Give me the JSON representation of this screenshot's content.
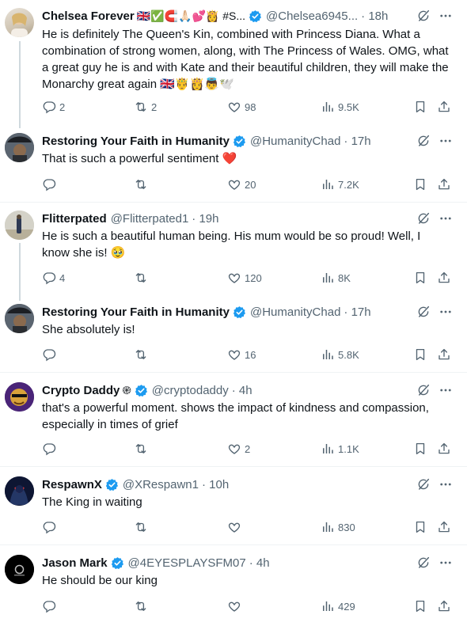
{
  "tweets": [
    {
      "name": "Chelsea Forever",
      "name_emojis": "🇬🇧✅🧲🙏🏻💕👸 #S...",
      "handle": "@Chelsea6945...",
      "time": "· 18h",
      "body": "He is definitely The Queen's Kin, combined with Princess Diana. What a combination of strong women, along, with The Princess of Wales. OMG, what a great guy he is and with Kate and their beautiful children, they will make the Monarchy great again 🇬🇧🤴👸👼🕊️",
      "replies": "2",
      "reposts": "2",
      "likes": "98",
      "views": "9.5K"
    },
    {
      "name": "Restoring Your Faith in Humanity",
      "handle": "@HumanityChad",
      "time": "· 17h",
      "body": "That is such a powerful sentiment",
      "body_emoji": "❤️",
      "replies": "",
      "reposts": "",
      "likes": "20",
      "views": "7.2K"
    },
    {
      "name": "Flitterpated",
      "handle": "@Flitterpated1",
      "time": "· 19h",
      "body": "He is such a beautiful human being.  His mum would be so proud! Well, I know she is!  🥹",
      "replies": "4",
      "reposts": "",
      "likes": "120",
      "views": "8K"
    },
    {
      "name": "Restoring Your Faith in Humanity",
      "handle": "@HumanityChad",
      "time": "· 17h",
      "body": "She absolutely is!",
      "replies": "",
      "reposts": "",
      "likes": "16",
      "views": "5.8K"
    },
    {
      "name": "Crypto Daddy",
      "name_emojis": "֎",
      "handle": "@cryptodaddy",
      "time": "· 4h",
      "body": "that's a powerful moment. shows the impact of kindness and compassion, especially in times of grief",
      "replies": "",
      "reposts": "",
      "likes": "2",
      "views": "1.1K"
    },
    {
      "name": "RespawnX",
      "handle": "@XRespawn1",
      "time": "· 10h",
      "body": "The King in waiting",
      "replies": "",
      "reposts": "",
      "likes": "",
      "views": "830"
    },
    {
      "name": "Jason Mark",
      "handle": "@4EYESPLAYSFM07",
      "time": "· 4h",
      "body": "He should be our king",
      "replies": "",
      "reposts": "",
      "likes": "",
      "views": "429"
    }
  ],
  "colors": {
    "text": "#0f1419",
    "secondary": "#536471",
    "verified": "#1d9bf0",
    "divider": "#eff3f4",
    "thread": "#cfd9de"
  },
  "icons": [
    "reply-icon",
    "repost-icon",
    "like-icon",
    "views-icon",
    "bookmark-icon",
    "share-icon",
    "grok-icon",
    "more-icon",
    "verified-badge-icon"
  ]
}
